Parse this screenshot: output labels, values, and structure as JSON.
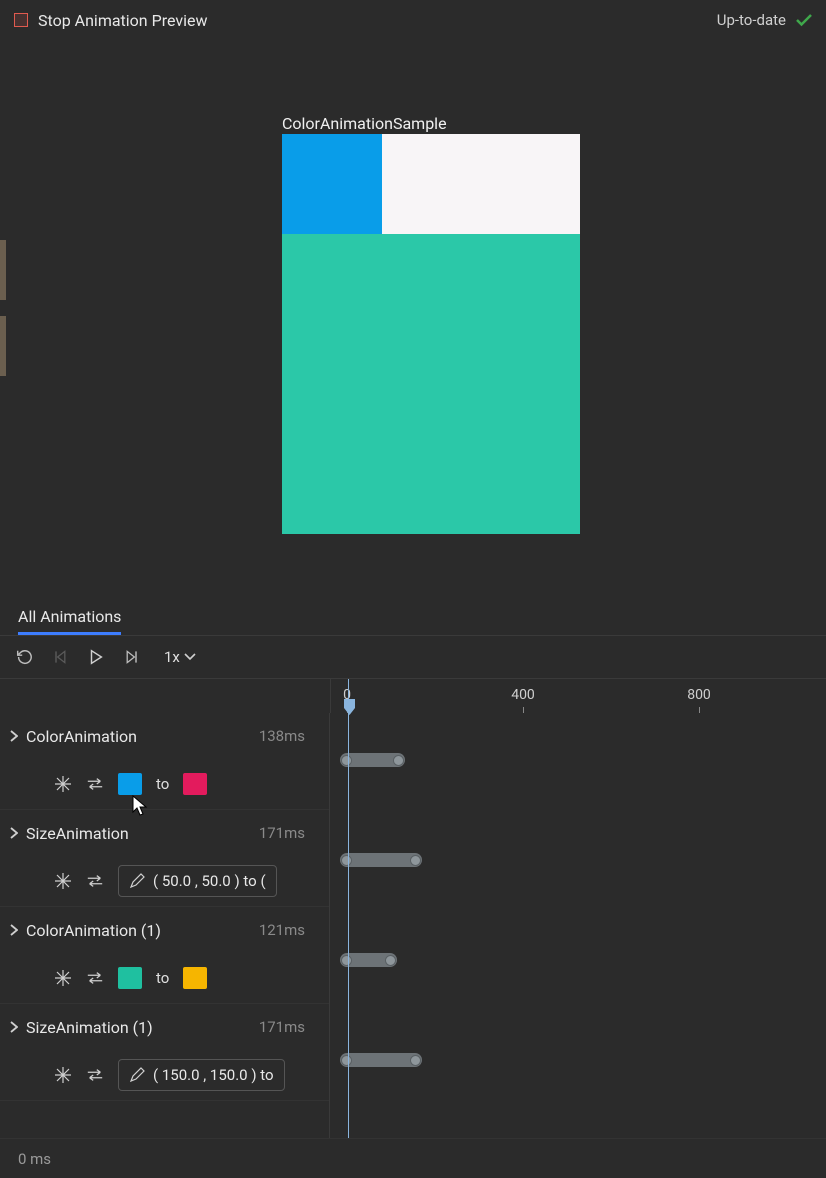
{
  "topbar": {
    "title": "Stop Animation Preview",
    "status": "Up-to-date"
  },
  "preview": {
    "title": "ColorAnimationSample",
    "blueColor": "#099de9",
    "whiteColor": "#f8f5f7",
    "tealColor": "#2bc8a8"
  },
  "tabs": {
    "active": "All Animations"
  },
  "controls": {
    "speed": "1x"
  },
  "timeline": {
    "ticks": [
      "0",
      "400",
      "800"
    ],
    "playhead_ms": 16,
    "footer_time": "0 ms"
  },
  "rows": [
    {
      "name": "ColorAnimation",
      "duration": "138ms",
      "type": "color",
      "fromColor": "#099de9",
      "toLabel": "to",
      "toColor": "#e31b5d",
      "bar_start": 10,
      "bar_end": 75
    },
    {
      "name": "SizeAnimation",
      "duration": "171ms",
      "type": "value",
      "valueText": "( 50.0 , 50.0 ) to (",
      "bar_start": 10,
      "bar_end": 92
    },
    {
      "name": "ColorAnimation (1)",
      "duration": "121ms",
      "type": "color",
      "fromColor": "#1fc0a0",
      "toLabel": "to",
      "toColor": "#f6b500",
      "bar_start": 10,
      "bar_end": 67
    },
    {
      "name": "SizeAnimation (1)",
      "duration": "171ms",
      "type": "value",
      "valueText": "( 150.0 , 150.0 ) to",
      "bar_start": 10,
      "bar_end": 92
    }
  ]
}
